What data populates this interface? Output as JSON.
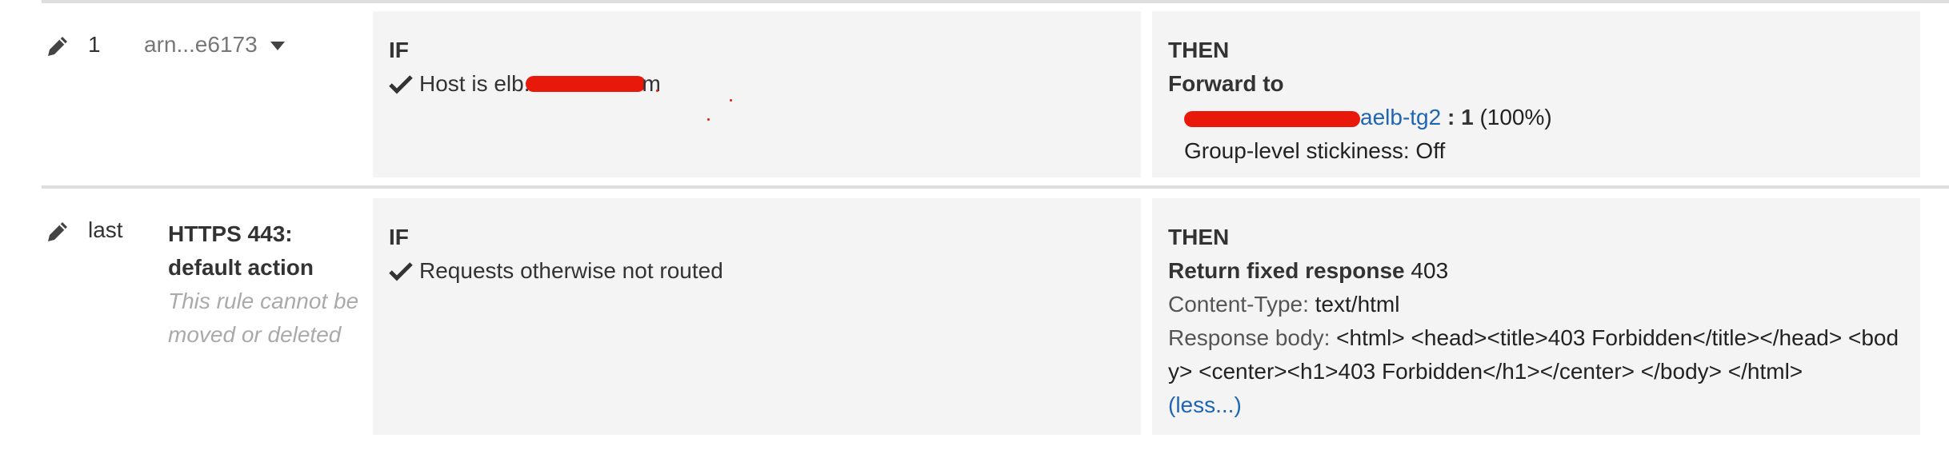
{
  "rules": [
    {
      "priority": "1",
      "target_select": "arn...e6173",
      "if_header": "IF",
      "condition_text": "Host is elb.",
      "condition_tail": "m",
      "then_header": "THEN",
      "action_title": "Forward to",
      "target_group_suffix": "aelb-tg2",
      "weight_sep": ":",
      "weight": "1",
      "weight_pct": "(100%)",
      "stickiness": "Group-level stickiness: Off"
    },
    {
      "priority": "last",
      "name": "HTTPS 443: default action",
      "note": "This rule cannot be moved or deleted",
      "if_header": "IF",
      "condition_text": "Requests otherwise not routed",
      "then_header": "THEN",
      "action_title": "Return fixed response",
      "status_code": "403",
      "content_type_label": "Content-Type:",
      "content_type_value": "text/html",
      "response_body_label": "Response body:",
      "response_body_value": "<html> <head><title>403 Forbidden</title></head> <body> <center><h1>403 Forbidden</h1></center> </body> </html>",
      "less_link": "(less...)"
    }
  ],
  "icons": {
    "edit": "pencil-icon",
    "check": "check-icon",
    "caret": "caret-down-icon"
  },
  "colors": {
    "link": "#1e66b4",
    "redaction": "#e8190b",
    "panel": "#f4f4f4"
  }
}
